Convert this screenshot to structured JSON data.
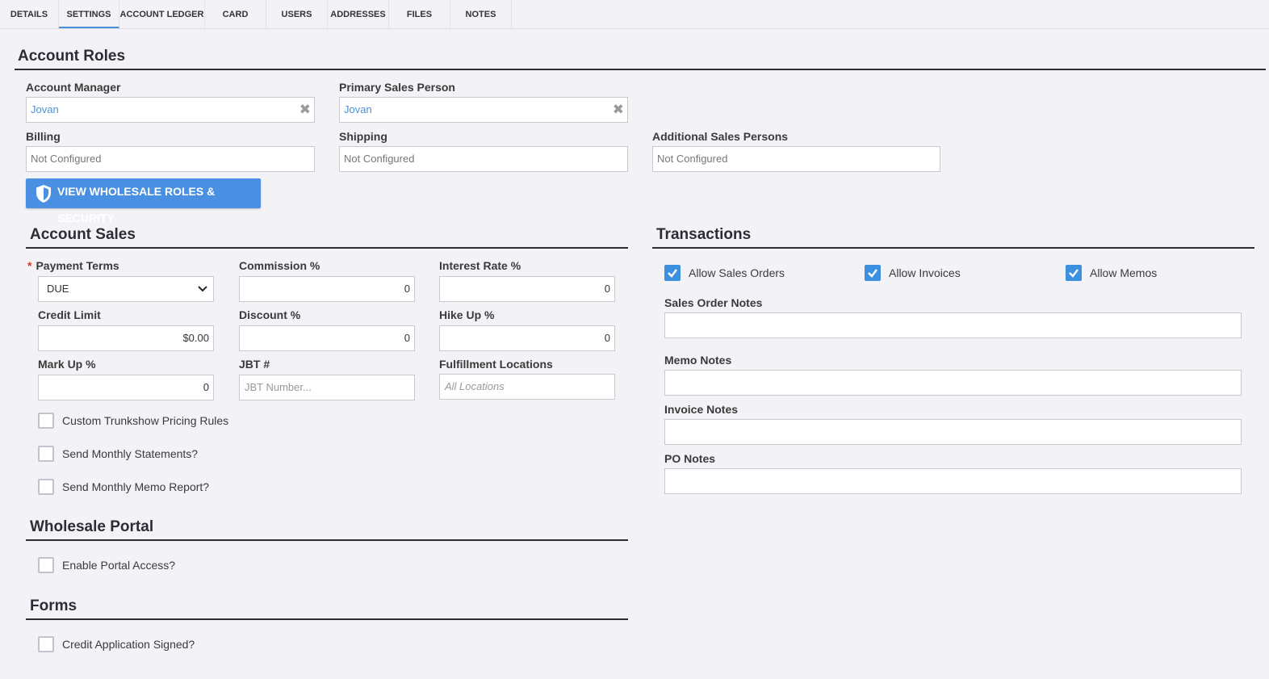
{
  "tabs": [
    "DETAILS",
    "SETTINGS",
    "ACCOUNT LEDGER",
    "CARD",
    "USERS",
    "ADDRESSES",
    "FILES",
    "NOTES"
  ],
  "active_tab": "SETTINGS",
  "account_roles": {
    "title": "Account Roles",
    "account_manager": {
      "label": "Account Manager",
      "value": "Jovan"
    },
    "primary_sales_person": {
      "label": "Primary Sales Person",
      "value": "Jovan"
    },
    "billing": {
      "label": "Billing",
      "value": "Not Configured"
    },
    "shipping": {
      "label": "Shipping",
      "value": "Not Configured"
    },
    "additional_sales_persons": {
      "label": "Additional Sales Persons",
      "value": "Not Configured"
    },
    "button_label": "VIEW WHOLESALE ROLES & SECURITY"
  },
  "account_sales": {
    "title": "Account Sales",
    "required_mark": "*",
    "payment_terms": {
      "label": "Payment Terms",
      "value": "DUE"
    },
    "commission": {
      "label": "Commission %",
      "value": "0"
    },
    "interest_rate": {
      "label": "Interest Rate %",
      "value": "0"
    },
    "credit_limit": {
      "label": "Credit Limit",
      "value": "$0.00"
    },
    "discount": {
      "label": "Discount %",
      "value": "0"
    },
    "hike_up": {
      "label": "Hike Up %",
      "value": "0"
    },
    "mark_up": {
      "label": "Mark Up %",
      "value": "0"
    },
    "jbt": {
      "label": "JBT #",
      "placeholder": "JBT Number..."
    },
    "fulfillment_locations": {
      "label": "Fulfillment Locations",
      "placeholder": "All Locations"
    },
    "custom_trunkshow": {
      "label": "Custom Trunkshow Pricing Rules",
      "checked": false
    },
    "send_monthly_statements": {
      "label": "Send Monthly Statements?",
      "checked": false
    },
    "send_monthly_memo_report": {
      "label": "Send Monthly Memo Report?",
      "checked": false
    }
  },
  "wholesale_portal": {
    "title": "Wholesale Portal",
    "enable_portal_access": {
      "label": "Enable Portal Access?",
      "checked": false
    }
  },
  "forms": {
    "title": "Forms",
    "credit_application_signed": {
      "label": "Credit Application Signed?",
      "checked": false
    }
  },
  "transactions": {
    "title": "Transactions",
    "allow_sales_orders": {
      "label": "Allow Sales Orders",
      "checked": true
    },
    "allow_invoices": {
      "label": "Allow Invoices",
      "checked": true
    },
    "allow_memos": {
      "label": "Allow Memos",
      "checked": true
    },
    "sales_order_notes": {
      "label": "Sales Order Notes",
      "value": ""
    },
    "memo_notes": {
      "label": "Memo Notes",
      "value": ""
    },
    "invoice_notes": {
      "label": "Invoice Notes",
      "value": ""
    },
    "po_notes": {
      "label": "PO Notes",
      "value": ""
    }
  },
  "colors": {
    "accent": "#4a90e2",
    "checkbox_checked": "#3d8fdf",
    "link_value": "#4a90d9",
    "required": "#d9342b",
    "rule": "#2c2c36"
  },
  "icons": {
    "clear": "close-icon",
    "button": "shield-icon",
    "select": "chevron-down-icon",
    "checkbox": "checkmark-icon"
  }
}
